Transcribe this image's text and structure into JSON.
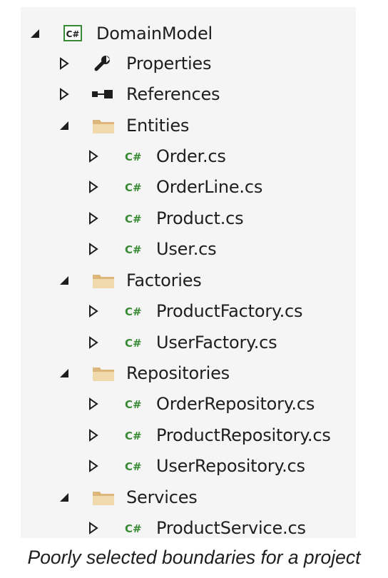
{
  "tree": {
    "project": {
      "label": "DomainModel",
      "icon": "csharp-project-icon",
      "expanded": true
    },
    "properties": {
      "label": "Properties",
      "icon": "wrench-icon"
    },
    "references": {
      "label": "References",
      "icon": "references-icon"
    },
    "folders": [
      {
        "label": "Entities",
        "icon": "folder-icon",
        "expanded": true,
        "files": [
          "Order.cs",
          "OrderLine.cs",
          "Product.cs",
          "User.cs"
        ]
      },
      {
        "label": "Factories",
        "icon": "folder-icon",
        "expanded": true,
        "files": [
          "ProductFactory.cs",
          "UserFactory.cs"
        ]
      },
      {
        "label": "Repositories",
        "icon": "folder-icon",
        "expanded": true,
        "files": [
          "OrderRepository.cs",
          "ProductRepository.cs",
          "UserRepository.cs"
        ]
      },
      {
        "label": "Services",
        "icon": "folder-icon",
        "expanded": true,
        "files": [
          "ProductService.cs"
        ]
      }
    ]
  },
  "caption": "Poorly selected boundaries for a project",
  "colors": {
    "panel_background": "#f5f5f5",
    "csharp_green": "#388a34",
    "folder_fill": "#dcb67a",
    "text": "#1e1e1e"
  }
}
